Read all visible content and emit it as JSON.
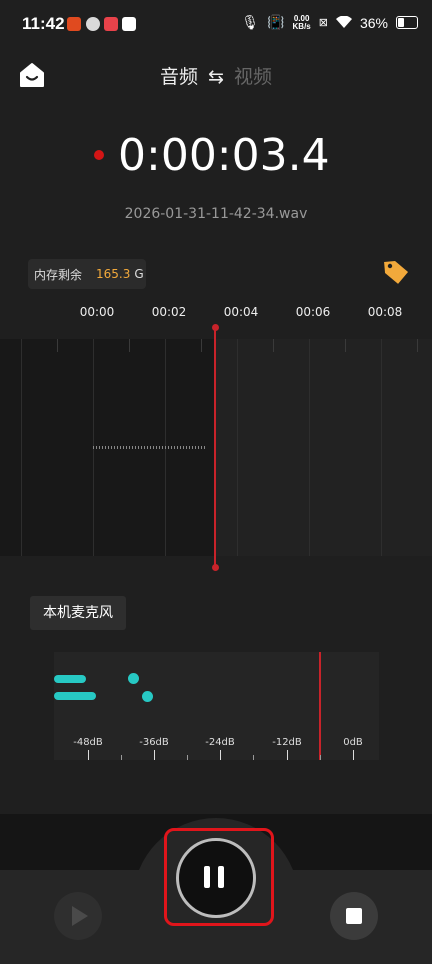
{
  "status_bar": {
    "time": "11:42",
    "net_speed_value": "0.00",
    "net_speed_unit": "KB/s",
    "battery": "36%"
  },
  "header": {
    "tab_audio": "音频",
    "swap_symbol": "⇆",
    "tab_video": "视频"
  },
  "recording": {
    "timer": "0:00:03.4",
    "filename": "2026-01-31-11-42-34.wav"
  },
  "storage": {
    "label": "内存剩余",
    "amount": "165.3",
    "unit": "G"
  },
  "timeline": {
    "ticks": [
      "00:00",
      "00:02",
      "00:04",
      "00:06",
      "00:08"
    ]
  },
  "source": {
    "mic_label": "本机麦克风"
  },
  "meter": {
    "scale": [
      "-48dB",
      "-36dB",
      "-24dB",
      "-12dB",
      "0dB"
    ]
  },
  "colors": {
    "accent_red": "#c8232a",
    "level_cyan": "#27c9c4",
    "storage_amount": "#f2a93b",
    "tag_icon": "#f2a93b"
  }
}
